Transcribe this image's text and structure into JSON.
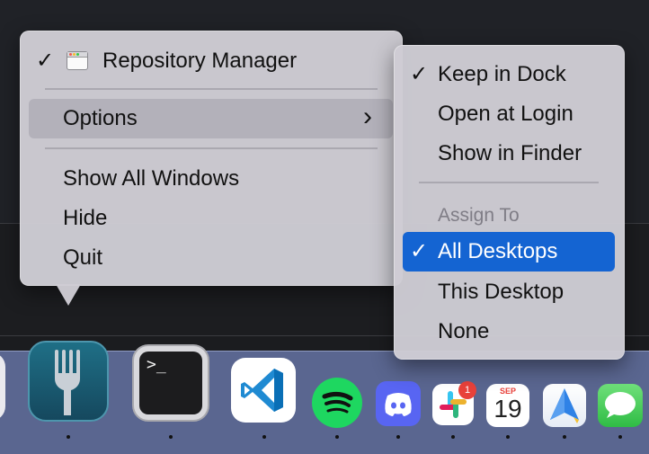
{
  "app_menu": {
    "title": "Repository Manager",
    "options_label": "Options",
    "items": [
      "Show All Windows",
      "Hide",
      "Quit"
    ],
    "check": "✓",
    "chevron": "›"
  },
  "options_submenu": {
    "items": [
      "Keep in Dock",
      "Open at Login",
      "Show in Finder"
    ],
    "assign_header": "Assign To",
    "assign_items": [
      "All Desktops",
      "This Desktop",
      "None"
    ]
  },
  "dock": {
    "apps": [
      "fork-icon",
      "terminal-icon",
      "vscode-icon",
      "spotify-icon",
      "discord-icon",
      "slack-icon",
      "calendar-icon",
      "spark-icon",
      "messages-icon"
    ],
    "slack_badge": "1",
    "calendar_month": "SEP",
    "calendar_day": "19",
    "terminal_prompt": ">_"
  },
  "colors": {
    "highlight": "#1464d2",
    "hover": "#b3b1ba",
    "menu_bg": "#cecdd4",
    "dock_bg": "#5a6690"
  }
}
